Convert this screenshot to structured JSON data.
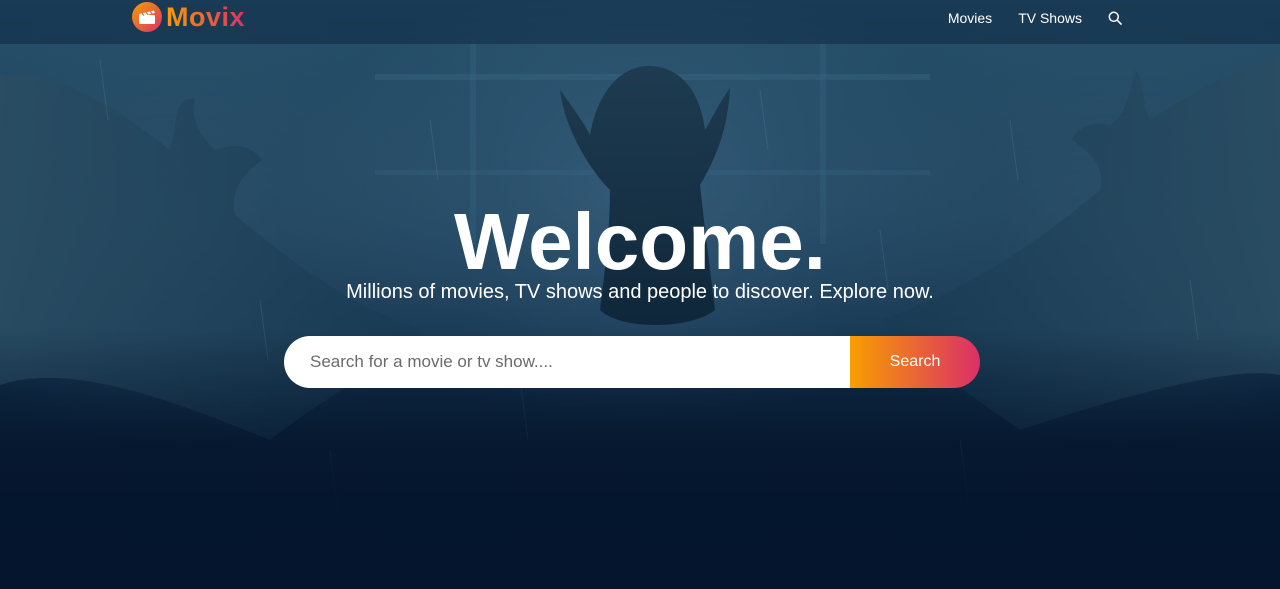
{
  "header": {
    "logo_text": "Movix",
    "logo_icon": "clapperboard-icon",
    "nav": {
      "movies_label": "Movies",
      "tv_shows_label": "TV Shows",
      "search_icon": "search-icon"
    }
  },
  "hero": {
    "title": "Welcome.",
    "subtitle": "Millions of movies, TV shows and people to discover. Explore now.",
    "search": {
      "placeholder": "Search for a movie or tv show....",
      "value": "",
      "button_label": "Search"
    }
  },
  "colors": {
    "background": "#04152d",
    "gradient_start": "#f89e00",
    "gradient_end": "#da2f68",
    "text": "#ffffff"
  }
}
